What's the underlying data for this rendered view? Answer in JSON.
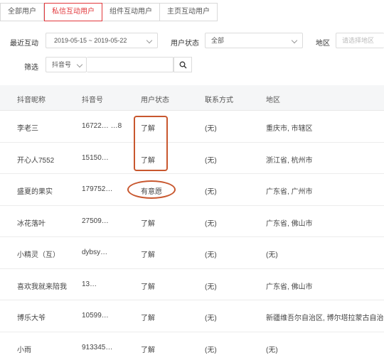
{
  "tabs": [
    {
      "label": "全部用户",
      "active": false
    },
    {
      "label": "私信互动用户",
      "active": true
    },
    {
      "label": "组件互动用户",
      "active": false
    },
    {
      "label": "主页互动用户",
      "active": false
    }
  ],
  "filters": {
    "recent_label": "最近互动",
    "date_range": "2019-05-15  ~  2019-05-22",
    "status_label": "用户状态",
    "status_value": "全部",
    "region_label": "地区",
    "region_placeholder": "请选择地区",
    "screen_label": "筛选",
    "screen_type": "抖音号"
  },
  "table": {
    "headers": [
      "抖音昵称",
      "抖音号",
      "用户状态",
      "联系方式",
      "地区"
    ],
    "rows": [
      {
        "nickname": "李老三",
        "id": "16722…  …8",
        "status": "了解",
        "contact": "(无)",
        "region": "重庆市, 市辖区"
      },
      {
        "nickname": "开心人7552",
        "id": "15150…",
        "status": "了解",
        "contact": "(无)",
        "region": "浙江省, 杭州市"
      },
      {
        "nickname": "盛夏的果实",
        "id": "179752…",
        "status": "有意愿",
        "contact": "(无)",
        "region": "广东省, 广州市"
      },
      {
        "nickname": "冰花落叶",
        "id": "27509…",
        "status": "了解",
        "contact": "(无)",
        "region": "广东省, 佛山市"
      },
      {
        "nickname": "小精灵（互）",
        "id": "dybsy…",
        "status": "了解",
        "contact": "(无)",
        "region": "(无)"
      },
      {
        "nickname": "喜欢我就来陪我",
        "id": "13…",
        "status": "了解",
        "contact": "(无)",
        "region": "广东省, 佛山市"
      },
      {
        "nickname": "博乐大爷",
        "id": "10599…",
        "status": "了解",
        "contact": "(无)",
        "region": "新疆维吾尔自治区, 博尔塔拉蒙古自治"
      },
      {
        "nickname": "小雨",
        "id": "913345…",
        "status": "了解",
        "contact": "(无)",
        "region": "(无)"
      }
    ]
  },
  "colors": {
    "accent": "#e2383c",
    "annotation": "#c8572e",
    "header_bg": "#f5f6f7"
  },
  "icons": {
    "search": "search-icon",
    "dropdown": "chevron-down-icon"
  }
}
